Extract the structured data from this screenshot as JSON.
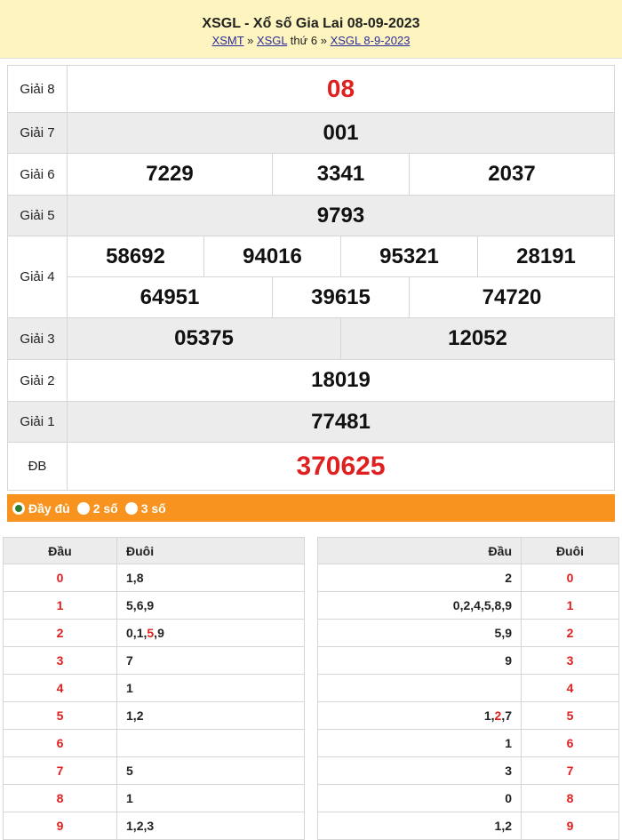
{
  "header": {
    "title": "XSGL - Xổ số Gia Lai 08-09-2023",
    "crumb": {
      "link1": "XSMT",
      "sep1": " » ",
      "link2": "XSGL",
      "mid": " thứ 6 » ",
      "link3": "XSGL 8-9-2023"
    }
  },
  "prizes": {
    "g8": {
      "label": "Giải 8",
      "values": [
        "08"
      ]
    },
    "g7": {
      "label": "Giải 7",
      "values": [
        "001"
      ]
    },
    "g6": {
      "label": "Giải 6",
      "values": [
        "7229",
        "3341",
        "2037"
      ]
    },
    "g5": {
      "label": "Giải 5",
      "values": [
        "9793"
      ]
    },
    "g4": {
      "label": "Giải 4",
      "values": [
        "58692",
        "94016",
        "95321",
        "28191",
        "64951",
        "39615",
        "74720"
      ]
    },
    "g3": {
      "label": "Giải 3",
      "values": [
        "05375",
        "12052"
      ]
    },
    "g2": {
      "label": "Giải 2",
      "values": [
        "18019"
      ]
    },
    "g1": {
      "label": "Giải 1",
      "values": [
        "77481"
      ]
    },
    "db": {
      "label": "ĐB",
      "values": [
        "370625"
      ]
    }
  },
  "options": {
    "full": "Đầy đủ",
    "two": "2 số",
    "three": "3 số",
    "selected": "full"
  },
  "colors": {
    "accent": "#f7931e",
    "red": "#e02020",
    "header_bg": "#fdf4bf"
  },
  "loto_dau": {
    "col_head": "Đầu",
    "col_tail": "Đuôi",
    "rows": [
      {
        "head": "0",
        "tail": [
          "1",
          "8"
        ]
      },
      {
        "head": "1",
        "tail": [
          "5",
          "6",
          "9"
        ]
      },
      {
        "head": "2",
        "tail": [
          "0",
          "1",
          "5",
          "9"
        ],
        "red_index": 2
      },
      {
        "head": "3",
        "tail": [
          "7"
        ]
      },
      {
        "head": "4",
        "tail": [
          "1"
        ]
      },
      {
        "head": "5",
        "tail": [
          "1",
          "2"
        ]
      },
      {
        "head": "6",
        "tail": []
      },
      {
        "head": "7",
        "tail": [
          "5"
        ]
      },
      {
        "head": "8",
        "tail": [
          "1"
        ]
      },
      {
        "head": "9",
        "tail": [
          "1",
          "2",
          "3"
        ]
      }
    ]
  },
  "loto_duoi": {
    "col_head": "Đầu",
    "col_tail": "Đuôi",
    "rows": [
      {
        "tail": "0",
        "head": [
          "2"
        ]
      },
      {
        "tail": "1",
        "head": [
          "0",
          "2",
          "4",
          "5",
          "8",
          "9"
        ]
      },
      {
        "tail": "2",
        "head": [
          "5",
          "9"
        ]
      },
      {
        "tail": "3",
        "head": [
          "9"
        ]
      },
      {
        "tail": "4",
        "head": []
      },
      {
        "tail": "5",
        "head": [
          "1",
          "2",
          "7"
        ],
        "red_index": 1
      },
      {
        "tail": "6",
        "head": [
          "1"
        ]
      },
      {
        "tail": "7",
        "head": [
          "3"
        ]
      },
      {
        "tail": "8",
        "head": [
          "0"
        ]
      },
      {
        "tail": "9",
        "head": [
          "1",
          "2"
        ]
      }
    ]
  }
}
